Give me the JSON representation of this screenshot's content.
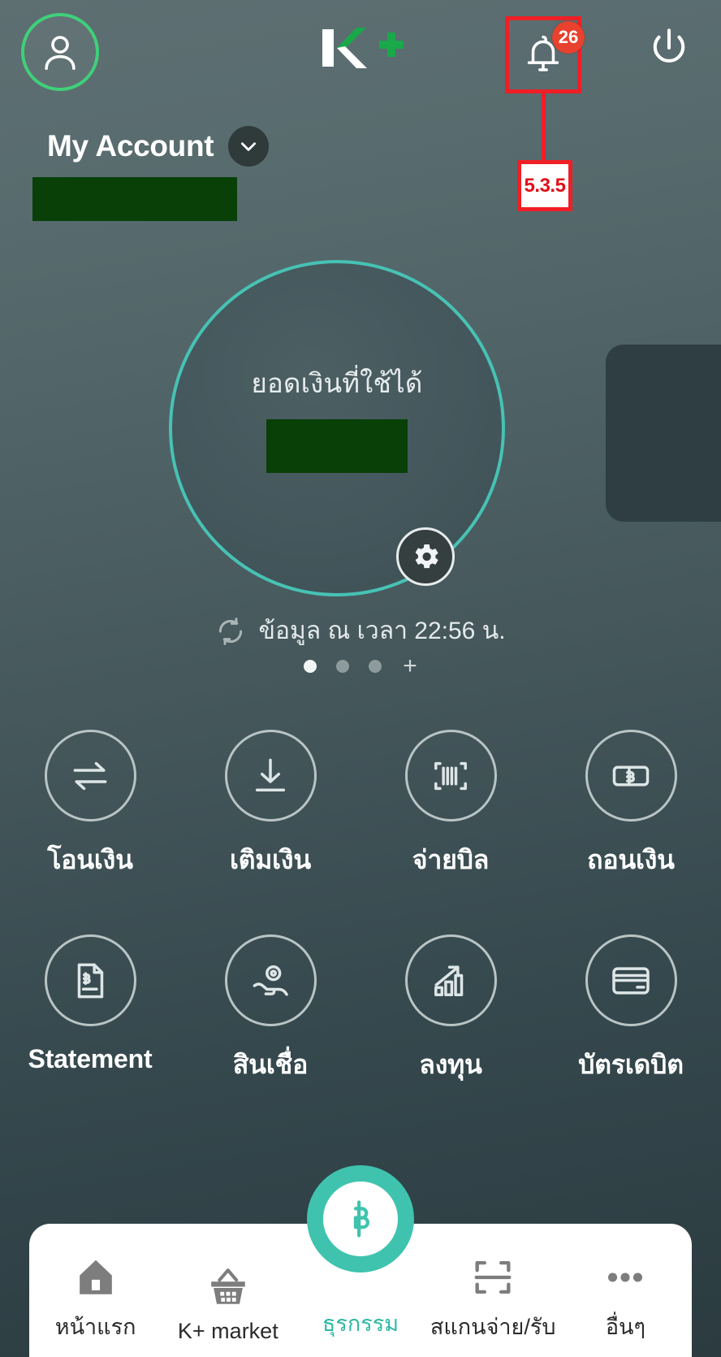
{
  "app": {
    "brand_name": "K+",
    "version_annotation": "5.3.5",
    "colors": {
      "accent_teal": "#3fc3ae",
      "dial_ring": "#47c2b4",
      "brand_green": "#19a84a",
      "avatar_ring": "#3fd07a",
      "annotation_red": "#ef1f26",
      "badge_red": "#e8412e",
      "redaction_green": "#084008",
      "background": "#46585c"
    }
  },
  "topbar": {
    "avatar_icon": "user-icon",
    "notification_icon": "bell-icon",
    "notification_count": "26",
    "power_icon": "power-icon"
  },
  "account": {
    "name": "My Account",
    "chevron_icon": "chevron-down-icon",
    "number_redacted": ""
  },
  "balance": {
    "label": "ยอดเงินที่ใช้ได้",
    "amount_redacted": "",
    "settings_icon": "gear-icon"
  },
  "status": {
    "refresh_icon": "refresh-icon",
    "text": "ข้อมูล ณ เวลา 22:56 น."
  },
  "pager": {
    "dots": [
      {
        "active": true
      },
      {
        "active": false
      },
      {
        "active": false
      }
    ],
    "add_label": "+"
  },
  "actions": [
    {
      "label": "โอนเงิน",
      "icon": "transfer-icon"
    },
    {
      "label": "เติมเงิน",
      "icon": "deposit-icon"
    },
    {
      "label": "จ่ายบิล",
      "icon": "barcode-icon"
    },
    {
      "label": "ถอนเงิน",
      "icon": "banknote-baht-icon"
    },
    {
      "label": "Statement",
      "icon": "document-baht-icon"
    },
    {
      "label": "สินเชื่อ",
      "icon": "hand-coin-icon"
    },
    {
      "label": "ลงทุน",
      "icon": "growth-chart-icon"
    },
    {
      "label": "บัตรเดบิต",
      "icon": "credit-card-icon"
    }
  ],
  "bottom_nav": [
    {
      "label": "หน้าแรก",
      "icon": "home-icon",
      "active": false
    },
    {
      "label": "K+ market",
      "icon": "basket-icon",
      "active": false
    },
    {
      "label": "ธุรกรรม",
      "icon": "baht-circle-icon",
      "active": true
    },
    {
      "label": "สแกนจ่าย/รับ",
      "icon": "scan-icon",
      "active": false
    },
    {
      "label": "อื่นๆ",
      "icon": "more-dots-icon",
      "active": false
    }
  ]
}
